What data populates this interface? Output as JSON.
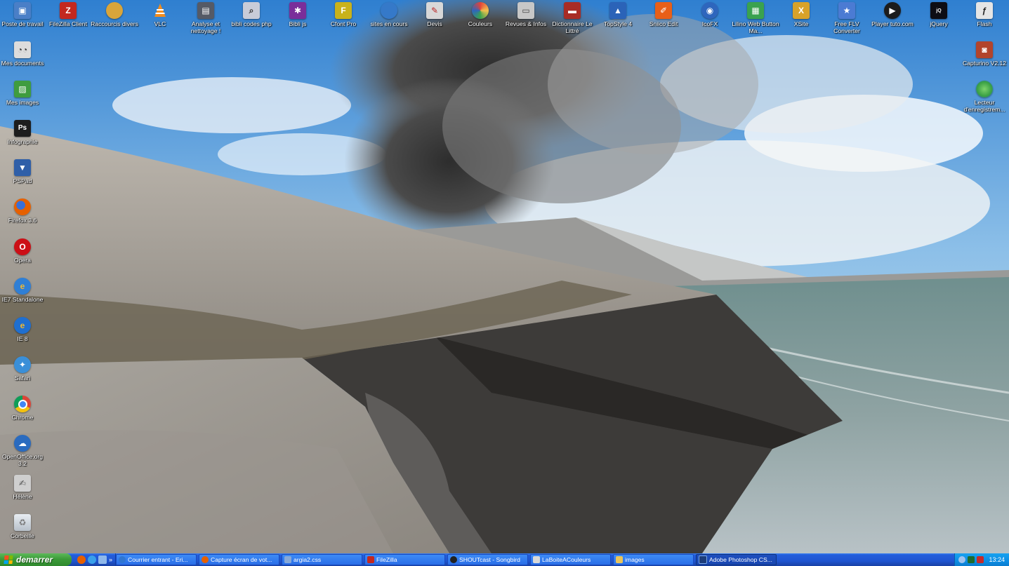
{
  "desktop": {
    "top_icons": [
      {
        "label": "Poste de travail",
        "icon": "computer-icon",
        "color": "#4a7fc7"
      },
      {
        "label": "FileZilla Client",
        "icon": "filezilla-icon",
        "color": "#c3281f"
      },
      {
        "label": "Raccourcis divers",
        "icon": "globe-icon",
        "color": "#d9a53a"
      },
      {
        "label": "VLC",
        "icon": "vlc-cone-icon",
        "color": "#f28c1d"
      },
      {
        "label": "Analyse et nettoyage !",
        "icon": "cleaner-icon",
        "color": "#555a66"
      },
      {
        "label": "bibli codes php",
        "icon": "magnifier-icon",
        "color": "#c8ccd8"
      },
      {
        "label": "Bibli js",
        "icon": "js-library-icon",
        "color": "#7a2e9a"
      },
      {
        "label": "Cfont Pro",
        "icon": "font-icon",
        "color": "#c9b21b"
      },
      {
        "label": "sites en cours",
        "icon": "globe-icon",
        "color": "#3579c9"
      },
      {
        "label": "Devis",
        "icon": "document-icon",
        "color": "#d8d8d8"
      },
      {
        "label": "Couleurs",
        "icon": "color-wheel-icon",
        "color": "#e2433a"
      },
      {
        "label": "Revues & Infos",
        "icon": "folder-icon",
        "color": "#c7c7c7"
      },
      {
        "label": "Dictionnaire Le Littré",
        "icon": "book-icon",
        "color": "#a82c25"
      },
      {
        "label": "TopStyle 4",
        "icon": "topstyle-icon",
        "color": "#2b63b8"
      },
      {
        "label": "Sniico Edit",
        "icon": "brush-icon",
        "color": "#e85f18"
      },
      {
        "label": "IcoFX",
        "icon": "icofx-icon",
        "color": "#2e66bd"
      },
      {
        "label": "Lilino Web Button Ma...",
        "icon": "web-button-icon",
        "color": "#3aa24f"
      },
      {
        "label": "XSite",
        "icon": "xsite-icon",
        "color": "#d8a22a"
      },
      {
        "label": "Free FLV Converter",
        "icon": "flv-converter-icon",
        "color": "#4b7bd3"
      },
      {
        "label": "Player tuto.com",
        "icon": "player-icon",
        "color": "#1c1c1c"
      },
      {
        "label": "jQuery",
        "icon": "jquery-icon",
        "color": "#0d0d14"
      },
      {
        "label": "Flash",
        "icon": "flash-icon",
        "color": "#e5e5e5"
      }
    ],
    "left_icons": [
      {
        "label": "Mes documents",
        "icon": "documents-icon",
        "color": "#dcdcdc"
      },
      {
        "label": "Mes images",
        "icon": "images-icon",
        "color": "#3f9c3f"
      },
      {
        "label": "Infographie",
        "icon": "photoshop-icon",
        "color": "#1d1d1d"
      },
      {
        "label": "PSPad",
        "icon": "pspad-icon",
        "color": "#2f5fa8"
      },
      {
        "label": "Firefox 3.6",
        "icon": "firefox-icon",
        "color": "#e66000"
      },
      {
        "label": "Opera",
        "icon": "opera-icon",
        "color": "#cc0f16"
      },
      {
        "label": "IE7 Standalone",
        "icon": "ie-icon",
        "color": "#2f7fd6"
      },
      {
        "label": "IE 8",
        "icon": "ie-icon",
        "color": "#1f6fd0"
      },
      {
        "label": "Safari",
        "icon": "safari-icon",
        "color": "#3a8fd8"
      },
      {
        "label": "Chrome",
        "icon": "chrome-icon",
        "color": "#3ba53f"
      },
      {
        "label": "OpenOffice.org 3.2",
        "icon": "openoffice-icon",
        "color": "#2a6bbf"
      },
      {
        "label": "Hélène",
        "icon": "pen-icon",
        "color": "#cfcfcf"
      },
      {
        "label": "Corbeille",
        "icon": "recycle-bin-icon",
        "color": "#c9d0d8"
      }
    ],
    "right_icons": [
      {
        "label": "Capturino V2.12",
        "icon": "capture-icon",
        "color": "#b2442c"
      },
      {
        "label": "Lecteur d'enregistrem...",
        "icon": "recorder-icon",
        "color": "#3aa044"
      }
    ]
  },
  "taskbar": {
    "start_label": "demarrer",
    "quicklaunch": [
      {
        "icon": "firefox-icon",
        "color": "#e66000"
      },
      {
        "icon": "ie-icon",
        "color": "#39a0ea"
      },
      {
        "icon": "pspad-icon",
        "color": "#8fb8ea"
      }
    ],
    "quicklaunch_more": "»",
    "tasks": [
      {
        "label": "Courrier entrant - Eri...",
        "icon": "thunderbird-icon",
        "color": "#2f76d2",
        "active": false
      },
      {
        "label": "Capture écran de vot...",
        "icon": "firefox-icon",
        "color": "#e66000",
        "active": false
      },
      {
        "label": "argia2.css",
        "icon": "pspad-icon",
        "color": "#87a9d8",
        "active": false
      },
      {
        "label": "FileZilla",
        "icon": "filezilla-icon",
        "color": "#c3281f",
        "active": false
      },
      {
        "label": "SHOUTcast - Songbird",
        "icon": "songbird-icon",
        "color": "#222222",
        "active": false
      },
      {
        "label": "LaBoiteACouleurs",
        "icon": "color-box-icon",
        "color": "#d8d8d8",
        "active": false
      },
      {
        "label": "images",
        "icon": "folder-icon",
        "color": "#e9c45b",
        "active": false
      },
      {
        "label": "Adobe Photoshop CS...",
        "icon": "photoshop-icon",
        "color": "#1d3d7a",
        "active": true
      }
    ],
    "tray": {
      "icons": [
        {
          "icon": "volume-icon",
          "color": "#9fc3ee"
        },
        {
          "icon": "network-icon",
          "color": "#1c6b2e"
        },
        {
          "icon": "antivirus-icon",
          "color": "#c52b2b"
        }
      ],
      "clock": "13:24"
    }
  }
}
